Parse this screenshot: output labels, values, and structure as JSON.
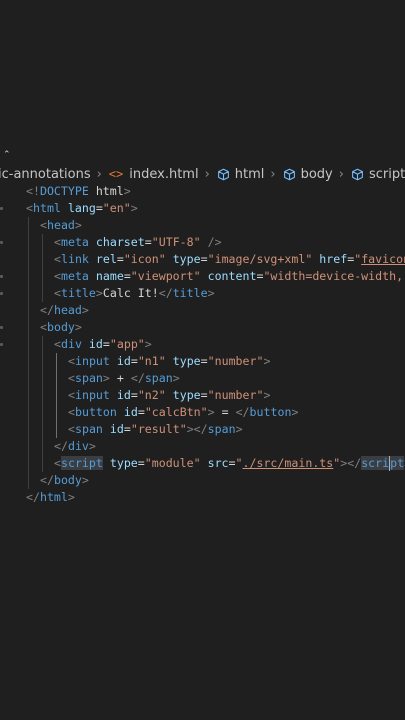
{
  "breadcrumb": {
    "folder": "ic-annotations",
    "file": "index.html",
    "symbols": [
      "html",
      "body",
      "script"
    ]
  },
  "code_lines": [
    {
      "indent": 0,
      "tokens": [
        [
          "punct",
          "<!"
        ],
        [
          "tag",
          "DOCTYPE"
        ],
        [
          "text",
          " html"
        ],
        [
          "punct",
          ">"
        ]
      ]
    },
    {
      "indent": 0,
      "tokens": [
        [
          "punct",
          "<"
        ],
        [
          "tag",
          "html"
        ],
        [
          "text",
          " "
        ],
        [
          "attr",
          "lang"
        ],
        [
          "text",
          "="
        ],
        [
          "str",
          "\"en\""
        ],
        [
          "punct",
          ">"
        ]
      ]
    },
    {
      "indent": 1,
      "tokens": [
        [
          "punct",
          "<"
        ],
        [
          "tag",
          "head"
        ],
        [
          "punct",
          ">"
        ]
      ]
    },
    {
      "indent": 2,
      "tokens": [
        [
          "punct",
          "<"
        ],
        [
          "tag",
          "meta"
        ],
        [
          "text",
          " "
        ],
        [
          "attr",
          "charset"
        ],
        [
          "text",
          "="
        ],
        [
          "str",
          "\"UTF-8\""
        ],
        [
          "text",
          " "
        ],
        [
          "punct",
          "/>"
        ]
      ]
    },
    {
      "indent": 2,
      "tokens": [
        [
          "punct",
          "<"
        ],
        [
          "tag",
          "link"
        ],
        [
          "text",
          " "
        ],
        [
          "attr",
          "rel"
        ],
        [
          "text",
          "="
        ],
        [
          "str",
          "\"icon\""
        ],
        [
          "text",
          " "
        ],
        [
          "attr",
          "type"
        ],
        [
          "text",
          "="
        ],
        [
          "str",
          "\"image/svg+xml\""
        ],
        [
          "text",
          " "
        ],
        [
          "attr",
          "href"
        ],
        [
          "text",
          "="
        ],
        [
          "str",
          "\""
        ],
        [
          "strlink",
          "favicon."
        ]
      ]
    },
    {
      "indent": 2,
      "tokens": [
        [
          "punct",
          "<"
        ],
        [
          "tag",
          "meta"
        ],
        [
          "text",
          " "
        ],
        [
          "attr",
          "name"
        ],
        [
          "text",
          "="
        ],
        [
          "str",
          "\"viewport\""
        ],
        [
          "text",
          " "
        ],
        [
          "attr",
          "content"
        ],
        [
          "text",
          "="
        ],
        [
          "str",
          "\"width=device-width, i"
        ]
      ]
    },
    {
      "indent": 2,
      "tokens": [
        [
          "punct",
          "<"
        ],
        [
          "tag",
          "title"
        ],
        [
          "punct",
          ">"
        ],
        [
          "text",
          "Calc It!"
        ],
        [
          "punct",
          "</"
        ],
        [
          "tag",
          "title"
        ],
        [
          "punct",
          ">"
        ]
      ]
    },
    {
      "indent": 1,
      "tokens": [
        [
          "punct",
          "</"
        ],
        [
          "tag",
          "head"
        ],
        [
          "punct",
          ">"
        ]
      ]
    },
    {
      "indent": 1,
      "tokens": [
        [
          "punct",
          "<"
        ],
        [
          "tag",
          "body"
        ],
        [
          "punct",
          ">"
        ]
      ]
    },
    {
      "indent": 2,
      "tokens": [
        [
          "punct",
          "<"
        ],
        [
          "tag",
          "div"
        ],
        [
          "text",
          " "
        ],
        [
          "attr",
          "id"
        ],
        [
          "text",
          "="
        ],
        [
          "str",
          "\"app\""
        ],
        [
          "punct",
          ">"
        ]
      ]
    },
    {
      "indent": 3,
      "tokens": [
        [
          "punct",
          "<"
        ],
        [
          "tag",
          "input"
        ],
        [
          "text",
          " "
        ],
        [
          "attr",
          "id"
        ],
        [
          "text",
          "="
        ],
        [
          "str",
          "\"n1\""
        ],
        [
          "text",
          " "
        ],
        [
          "attr",
          "type"
        ],
        [
          "text",
          "="
        ],
        [
          "str",
          "\"number\""
        ],
        [
          "punct",
          ">"
        ]
      ]
    },
    {
      "indent": 3,
      "tokens": [
        [
          "punct",
          "<"
        ],
        [
          "tag",
          "span"
        ],
        [
          "punct",
          ">"
        ],
        [
          "text",
          " + "
        ],
        [
          "punct",
          "</"
        ],
        [
          "tag",
          "span"
        ],
        [
          "punct",
          ">"
        ]
      ]
    },
    {
      "indent": 3,
      "tokens": [
        [
          "punct",
          "<"
        ],
        [
          "tag",
          "input"
        ],
        [
          "text",
          " "
        ],
        [
          "attr",
          "id"
        ],
        [
          "text",
          "="
        ],
        [
          "str",
          "\"n2\""
        ],
        [
          "text",
          " "
        ],
        [
          "attr",
          "type"
        ],
        [
          "text",
          "="
        ],
        [
          "str",
          "\"number\""
        ],
        [
          "punct",
          ">"
        ]
      ]
    },
    {
      "indent": 3,
      "tokens": [
        [
          "punct",
          "<"
        ],
        [
          "tag",
          "button"
        ],
        [
          "text",
          " "
        ],
        [
          "attr",
          "id"
        ],
        [
          "text",
          "="
        ],
        [
          "str",
          "\"calcBtn\""
        ],
        [
          "punct",
          ">"
        ],
        [
          "text",
          " = "
        ],
        [
          "punct",
          "</"
        ],
        [
          "tag",
          "button"
        ],
        [
          "punct",
          ">"
        ]
      ]
    },
    {
      "indent": 3,
      "tokens": [
        [
          "punct",
          "<"
        ],
        [
          "tag",
          "span"
        ],
        [
          "text",
          " "
        ],
        [
          "attr",
          "id"
        ],
        [
          "text",
          "="
        ],
        [
          "str",
          "\"result\""
        ],
        [
          "punct",
          "></"
        ],
        [
          "tag",
          "span"
        ],
        [
          "punct",
          ">"
        ]
      ]
    },
    {
      "indent": 2,
      "tokens": [
        [
          "punct",
          "</"
        ],
        [
          "tag",
          "div"
        ],
        [
          "punct",
          ">"
        ]
      ]
    },
    {
      "indent": 2,
      "tokens": [
        [
          "punct",
          "<"
        ],
        [
          "tagsel",
          "script"
        ],
        [
          "text",
          " "
        ],
        [
          "attr",
          "type"
        ],
        [
          "text",
          "="
        ],
        [
          "str",
          "\"module\""
        ],
        [
          "text",
          " "
        ],
        [
          "attr",
          "src"
        ],
        [
          "text",
          "="
        ],
        [
          "str",
          "\""
        ],
        [
          "strlink",
          "./src/main.ts"
        ],
        [
          "str",
          "\""
        ],
        [
          "punct",
          "></"
        ],
        [
          "tagsel",
          "scri"
        ],
        [
          "cursor",
          ""
        ],
        [
          "tagsel",
          "pt"
        ],
        [
          "punct",
          ">"
        ]
      ]
    },
    {
      "indent": 1,
      "tokens": [
        [
          "punct",
          "</"
        ],
        [
          "tag",
          "body"
        ],
        [
          "punct",
          ">"
        ]
      ]
    },
    {
      "indent": 0,
      "tokens": [
        [
          "punct",
          "</"
        ],
        [
          "tag",
          "html"
        ],
        [
          "punct",
          ">"
        ]
      ]
    }
  ],
  "colors": {
    "background": "#1f1f1f",
    "tag": "#569cd6",
    "attribute": "#9cdcfe",
    "string": "#ce9178",
    "punctuation": "#808080",
    "text": "#d4d4d4",
    "html_file_icon": "#e37933"
  },
  "icons": {
    "file": "html-file-icon",
    "symbol": "cube-icon",
    "separator": "chevron-right-icon"
  }
}
